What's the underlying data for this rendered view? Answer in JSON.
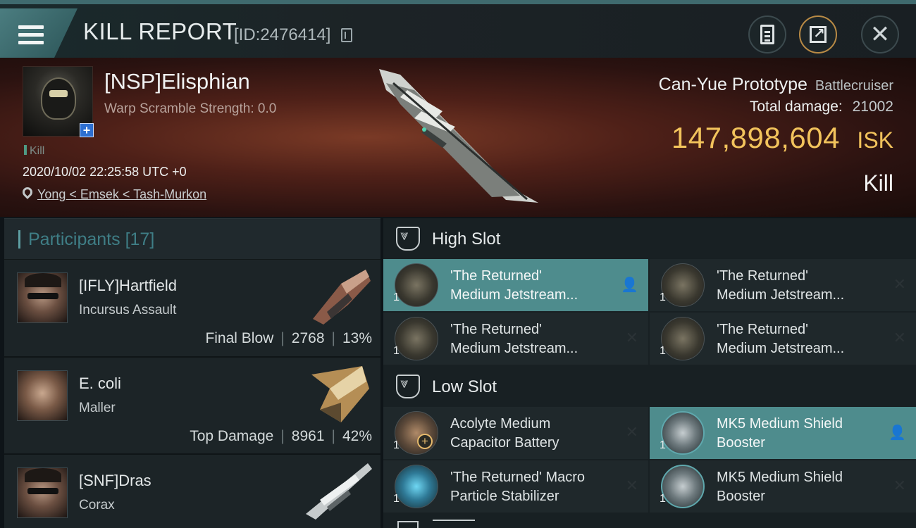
{
  "header": {
    "title": "KILL REPORT",
    "report_id": "[ID:2476414]",
    "icons": [
      "menu-icon",
      "copy-icon",
      "clipboard-icon",
      "share-icon",
      "close-icon"
    ]
  },
  "victim": {
    "name": "[NSP]Elisphian",
    "warp_scramble": "Warp Scramble Strength: 0.0",
    "kill_tag": "Kill",
    "datetime": "2020/10/02 22:25:58 UTC +0",
    "location": "Yong < Emsek < Tash-Murkon",
    "ship_name": "Can-Yue Prototype",
    "ship_class": "Battlecruiser",
    "total_damage_label": "Total damage:",
    "total_damage": "21002",
    "isk_value": "147,898,604",
    "isk_currency": "ISK",
    "result": "Kill"
  },
  "participants": {
    "title": "Participants",
    "count": "[17]",
    "rows": [
      {
        "name": "[IFLY]Hartfield",
        "ship": "Incursus Assault",
        "tag": "Final Blow",
        "damage": "2768",
        "percent": "13%"
      },
      {
        "name": "E. coli",
        "ship": "Maller",
        "tag": "Top Damage",
        "damage": "8961",
        "percent": "42%"
      },
      {
        "name": "[SNF]Dras",
        "ship": "Corax",
        "tag": "",
        "damage": "",
        "percent": ""
      }
    ]
  },
  "fitting": {
    "high_slot_title": "High Slot",
    "low_slot_title": "Low Slot",
    "high": [
      {
        "line1": "'The Returned'",
        "line2": "Medium Jetstream...",
        "qty": "1",
        "status": "person",
        "active": true
      },
      {
        "line1": "'The Returned'",
        "line2": "Medium Jetstream...",
        "qty": "1",
        "status": "destroyed",
        "active": false
      },
      {
        "line1": "'The Returned'",
        "line2": "Medium Jetstream...",
        "qty": "1",
        "status": "destroyed",
        "active": false
      },
      {
        "line1": "'The Returned'",
        "line2": "Medium Jetstream...",
        "qty": "1",
        "status": "destroyed",
        "active": false
      }
    ],
    "low": [
      {
        "line1": "Acolyte Medium",
        "line2": "Capacitor Battery",
        "qty": "1",
        "status": "destroyed",
        "active": false
      },
      {
        "line1": "MK5 Medium Shield",
        "line2": "Booster",
        "qty": "1",
        "status": "person",
        "active": true
      },
      {
        "line1": "'The Returned' Macro",
        "line2": "Particle Stabilizer",
        "qty": "1",
        "status": "destroyed",
        "active": false
      },
      {
        "line1": "MK5 Medium Shield",
        "line2": "Booster",
        "qty": "1",
        "status": "destroyed",
        "active": false
      }
    ]
  },
  "colors": {
    "accent": "#4e8c8d",
    "isk": "#f2c35c",
    "hero": "#4e2018"
  }
}
